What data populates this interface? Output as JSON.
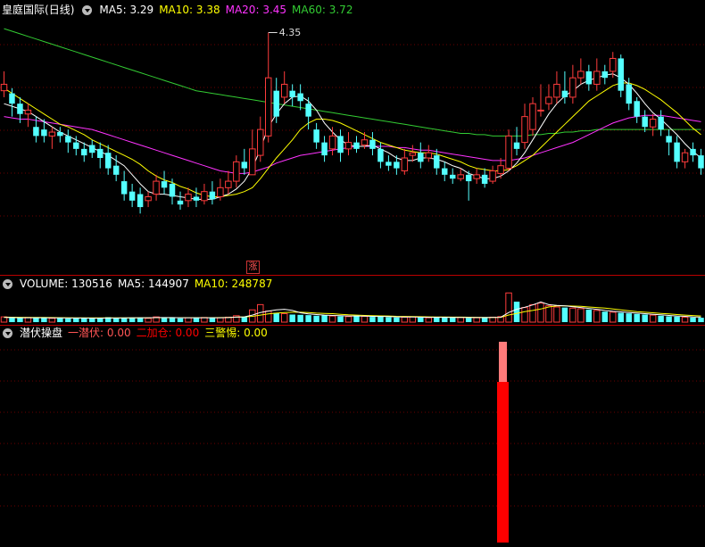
{
  "main": {
    "stock_name": "皇庭国际",
    "period": "(日线)",
    "ma5": {
      "label": "MA5:",
      "value": "3.29",
      "color": "#ffffff"
    },
    "ma10": {
      "label": "MA10:",
      "value": "3.38",
      "color": "#ffff00"
    },
    "ma20": {
      "label": "MA20:",
      "value": "3.45",
      "color": "#ff33ff"
    },
    "ma60": {
      "label": "MA60:",
      "value": "3.72",
      "color": "#33cc33"
    },
    "peak_label": "4.35",
    "up_marker": "涨"
  },
  "volume": {
    "label": "VOLUME:",
    "value": "130516",
    "ma5_label": "MA5:",
    "ma5_value": "144907",
    "ma10_label": "MA10:",
    "ma10_value": "248787"
  },
  "indicator": {
    "title": "潜伏操盘",
    "s1": {
      "label": "一潜伏:",
      "value": "0.00",
      "color": "#ff5555"
    },
    "s2": {
      "label": "二加仓:",
      "value": "0.00",
      "color": "#ff0000"
    },
    "s3": {
      "label": "三警惕:",
      "value": "0.00",
      "color": "#ffff00"
    },
    "bar": {
      "main_value": 1.0,
      "top_value": 0.25
    }
  },
  "chart_data": {
    "type": "candlestick",
    "price_range": [
      2.6,
      4.45
    ],
    "candles": [
      [
        3.9,
        3.95,
        4.05,
        3.85
      ],
      [
        3.88,
        3.8,
        3.92,
        3.7
      ],
      [
        3.8,
        3.72,
        3.85,
        3.65
      ],
      [
        3.72,
        3.75,
        3.8,
        3.62
      ],
      [
        3.62,
        3.55,
        3.7,
        3.5
      ],
      [
        3.6,
        3.55,
        3.68,
        3.5
      ],
      [
        3.55,
        3.58,
        3.62,
        3.45
      ],
      [
        3.58,
        3.55,
        3.62,
        3.5
      ],
      [
        3.55,
        3.5,
        3.6,
        3.42
      ],
      [
        3.5,
        3.45,
        3.55,
        3.4
      ],
      [
        3.45,
        3.4,
        3.5,
        3.35
      ],
      [
        3.48,
        3.42,
        3.52,
        3.38
      ],
      [
        3.45,
        3.38,
        3.5,
        3.3
      ],
      [
        3.42,
        3.3,
        3.48,
        3.25
      ],
      [
        3.32,
        3.25,
        3.4,
        3.2
      ],
      [
        3.2,
        3.1,
        3.28,
        3.05
      ],
      [
        3.12,
        3.05,
        3.18,
        3.0
      ],
      [
        3.1,
        3.0,
        3.15,
        2.95
      ],
      [
        3.05,
        3.08,
        3.12,
        3.0
      ],
      [
        3.1,
        3.2,
        3.25,
        3.05
      ],
      [
        3.2,
        3.15,
        3.28,
        3.1
      ],
      [
        3.18,
        3.08,
        3.22,
        3.02
      ],
      [
        3.05,
        3.02,
        3.12,
        2.98
      ],
      [
        3.05,
        3.1,
        3.15,
        3.0
      ],
      [
        3.08,
        3.05,
        3.15,
        3.0
      ],
      [
        3.05,
        3.12,
        3.18,
        3.02
      ],
      [
        3.12,
        3.06,
        3.2,
        3.02
      ],
      [
        3.08,
        3.15,
        3.22,
        3.05
      ],
      [
        3.15,
        3.2,
        3.28,
        3.1
      ],
      [
        3.2,
        3.35,
        3.4,
        3.15
      ],
      [
        3.35,
        3.3,
        3.45,
        3.25
      ],
      [
        3.25,
        3.45,
        3.6,
        3.25
      ],
      [
        3.4,
        3.6,
        3.7,
        3.35
      ],
      [
        3.55,
        4.0,
        4.35,
        3.5
      ],
      [
        3.9,
        3.7,
        4.0,
        3.65
      ],
      [
        3.85,
        3.95,
        4.05,
        3.8
      ],
      [
        3.9,
        3.85,
        3.95,
        3.78
      ],
      [
        3.88,
        3.82,
        3.95,
        3.75
      ],
      [
        3.8,
        3.7,
        3.85,
        3.6
      ],
      [
        3.6,
        3.5,
        3.65,
        3.45
      ],
      [
        3.5,
        3.4,
        3.55,
        3.35
      ],
      [
        3.45,
        3.55,
        3.62,
        3.4
      ],
      [
        3.55,
        3.42,
        3.6,
        3.35
      ],
      [
        3.45,
        3.5,
        3.58,
        3.4
      ],
      [
        3.5,
        3.45,
        3.55,
        3.42
      ],
      [
        3.48,
        3.52,
        3.58,
        3.45
      ],
      [
        3.52,
        3.45,
        3.58,
        3.4
      ],
      [
        3.45,
        3.35,
        3.5,
        3.3
      ],
      [
        3.35,
        3.32,
        3.4,
        3.28
      ],
      [
        3.35,
        3.3,
        3.4,
        3.25
      ],
      [
        3.28,
        3.38,
        3.45,
        3.25
      ],
      [
        3.4,
        3.42,
        3.48,
        3.35
      ],
      [
        3.42,
        3.35,
        3.5,
        3.3
      ],
      [
        3.38,
        3.42,
        3.48,
        3.35
      ],
      [
        3.4,
        3.3,
        3.45,
        3.25
      ],
      [
        3.3,
        3.25,
        3.35,
        3.2
      ],
      [
        3.25,
        3.22,
        3.3,
        3.18
      ],
      [
        3.22,
        3.25,
        3.3,
        3.2
      ],
      [
        3.25,
        3.2,
        3.28,
        3.05
      ],
      [
        3.22,
        3.25,
        3.3,
        3.18
      ],
      [
        3.25,
        3.18,
        3.3,
        3.15
      ],
      [
        3.2,
        3.28,
        3.32,
        3.18
      ],
      [
        3.26,
        3.32,
        3.38,
        3.22
      ],
      [
        3.3,
        3.55,
        3.6,
        3.28
      ],
      [
        3.5,
        3.45,
        3.62,
        3.4
      ],
      [
        3.5,
        3.7,
        3.8,
        3.45
      ],
      [
        3.6,
        3.8,
        3.85,
        3.55
      ],
      [
        3.75,
        3.75,
        3.95,
        3.7
      ],
      [
        3.8,
        3.85,
        3.95,
        3.75
      ],
      [
        3.85,
        3.95,
        4.05,
        3.8
      ],
      [
        3.9,
        3.85,
        4.05,
        3.8
      ],
      [
        3.85,
        4.0,
        4.1,
        3.8
      ],
      [
        4.0,
        4.05,
        4.15,
        3.95
      ],
      [
        4.05,
        3.95,
        4.1,
        3.9
      ],
      [
        3.95,
        4.05,
        4.15,
        3.9
      ],
      [
        4.05,
        4.0,
        4.1,
        3.95
      ],
      [
        4.05,
        4.15,
        4.2,
        4.0
      ],
      [
        4.15,
        3.9,
        4.18,
        3.85
      ],
      [
        3.95,
        3.8,
        4.0,
        3.75
      ],
      [
        3.82,
        3.7,
        3.85,
        3.65
      ],
      [
        3.7,
        3.62,
        3.75,
        3.58
      ],
      [
        3.62,
        3.68,
        3.72,
        3.55
      ],
      [
        3.7,
        3.6,
        3.75,
        3.55
      ],
      [
        3.55,
        3.5,
        3.6,
        3.4
      ],
      [
        3.5,
        3.35,
        3.55,
        3.3
      ],
      [
        3.35,
        3.42,
        3.45,
        3.3
      ],
      [
        3.45,
        3.4,
        3.5,
        3.35
      ],
      [
        3.4,
        3.3,
        3.45,
        3.25
      ]
    ],
    "ma5": [
      3.8,
      3.78,
      3.76,
      3.74,
      3.7,
      3.66,
      3.62,
      3.58,
      3.55,
      3.52,
      3.49,
      3.46,
      3.43,
      3.4,
      3.36,
      3.32,
      3.25,
      3.18,
      3.12,
      3.1,
      3.1,
      3.09,
      3.08,
      3.07,
      3.06,
      3.06,
      3.06,
      3.08,
      3.1,
      3.14,
      3.2,
      3.3,
      3.45,
      3.62,
      3.72,
      3.8,
      3.85,
      3.86,
      3.82,
      3.75,
      3.65,
      3.58,
      3.52,
      3.48,
      3.47,
      3.47,
      3.48,
      3.45,
      3.42,
      3.38,
      3.36,
      3.36,
      3.38,
      3.38,
      3.37,
      3.35,
      3.32,
      3.3,
      3.26,
      3.24,
      3.22,
      3.22,
      3.24,
      3.28,
      3.34,
      3.42,
      3.52,
      3.62,
      3.72,
      3.8,
      3.86,
      3.9,
      3.95,
      3.98,
      4.0,
      4.02,
      4.03,
      4.0,
      3.95,
      3.88,
      3.8,
      3.73,
      3.68,
      3.62,
      3.56,
      3.49,
      3.43,
      3.38
    ],
    "ma10": [
      3.92,
      3.88,
      3.84,
      3.8,
      3.76,
      3.72,
      3.68,
      3.64,
      3.62,
      3.59,
      3.56,
      3.52,
      3.49,
      3.46,
      3.43,
      3.4,
      3.37,
      3.33,
      3.28,
      3.24,
      3.21,
      3.19,
      3.16,
      3.14,
      3.11,
      3.09,
      3.08,
      3.08,
      3.09,
      3.1,
      3.12,
      3.15,
      3.22,
      3.3,
      3.38,
      3.45,
      3.52,
      3.6,
      3.65,
      3.68,
      3.68,
      3.67,
      3.65,
      3.62,
      3.59,
      3.56,
      3.53,
      3.5,
      3.48,
      3.46,
      3.44,
      3.43,
      3.42,
      3.42,
      3.41,
      3.39,
      3.37,
      3.35,
      3.32,
      3.3,
      3.29,
      3.28,
      3.28,
      3.29,
      3.32,
      3.36,
      3.4,
      3.46,
      3.52,
      3.58,
      3.64,
      3.7,
      3.76,
      3.82,
      3.86,
      3.9,
      3.94,
      3.96,
      3.96,
      3.94,
      3.91,
      3.87,
      3.83,
      3.78,
      3.73,
      3.67,
      3.61,
      3.56
    ],
    "ma20": [
      3.7,
      3.69,
      3.68,
      3.68,
      3.67,
      3.66,
      3.65,
      3.64,
      3.63,
      3.62,
      3.61,
      3.6,
      3.58,
      3.56,
      3.54,
      3.52,
      3.5,
      3.48,
      3.46,
      3.44,
      3.42,
      3.4,
      3.38,
      3.36,
      3.34,
      3.32,
      3.3,
      3.28,
      3.27,
      3.26,
      3.26,
      3.27,
      3.29,
      3.31,
      3.34,
      3.36,
      3.38,
      3.4,
      3.41,
      3.42,
      3.43,
      3.44,
      3.45,
      3.46,
      3.47,
      3.47,
      3.47,
      3.47,
      3.47,
      3.46,
      3.46,
      3.45,
      3.44,
      3.44,
      3.43,
      3.42,
      3.41,
      3.4,
      3.39,
      3.38,
      3.37,
      3.36,
      3.36,
      3.36,
      3.37,
      3.38,
      3.4,
      3.42,
      3.44,
      3.46,
      3.48,
      3.5,
      3.53,
      3.56,
      3.59,
      3.62,
      3.65,
      3.67,
      3.69,
      3.7,
      3.71,
      3.71,
      3.71,
      3.7,
      3.69,
      3.68,
      3.67,
      3.66
    ],
    "ma60": [
      4.38,
      4.36,
      4.34,
      4.32,
      4.3,
      4.28,
      4.26,
      4.24,
      4.22,
      4.2,
      4.18,
      4.16,
      4.14,
      4.12,
      4.1,
      4.08,
      4.06,
      4.04,
      4.02,
      4.0,
      3.98,
      3.96,
      3.94,
      3.92,
      3.9,
      3.89,
      3.88,
      3.87,
      3.86,
      3.85,
      3.84,
      3.83,
      3.82,
      3.81,
      3.8,
      3.79,
      3.78,
      3.77,
      3.76,
      3.75,
      3.74,
      3.73,
      3.72,
      3.71,
      3.7,
      3.69,
      3.68,
      3.67,
      3.66,
      3.65,
      3.64,
      3.63,
      3.62,
      3.61,
      3.6,
      3.59,
      3.58,
      3.57,
      3.57,
      3.56,
      3.56,
      3.55,
      3.55,
      3.55,
      3.55,
      3.55,
      3.56,
      3.56,
      3.57,
      3.57,
      3.58,
      3.58,
      3.59,
      3.59,
      3.6,
      3.6,
      3.6,
      3.6,
      3.6,
      3.6,
      3.6,
      3.6,
      3.6,
      3.6,
      3.6,
      3.6,
      3.6,
      3.6
    ],
    "volume_max": 1100000,
    "volumes": [
      180000,
      150000,
      140000,
      160000,
      150000,
      140000,
      130000,
      150000,
      120000,
      130000,
      140000,
      120000,
      150000,
      170000,
      130000,
      140000,
      150000,
      160000,
      130000,
      180000,
      150000,
      140000,
      130000,
      150000,
      140000,
      160000,
      140000,
      150000,
      170000,
      220000,
      180000,
      420000,
      600000,
      380000,
      320000,
      290000,
      260000,
      250000,
      240000,
      220000,
      230000,
      210000,
      200000,
      190000,
      220000,
      200000,
      180000,
      190000,
      170000,
      160000,
      170000,
      180000,
      160000,
      150000,
      170000,
      160000,
      150000,
      160000,
      140000,
      150000,
      160000,
      170000,
      190000,
      1000000,
      700000,
      500000,
      600000,
      650000,
      560000,
      520000,
      500000,
      480000,
      460000,
      430000,
      400000,
      360000,
      340000,
      320000,
      300000,
      280000,
      260000,
      240000,
      220000,
      200000,
      190000,
      170000,
      160000,
      150000
    ],
    "vol_ma5": [
      160000,
      155000,
      150000,
      150000,
      150000,
      150000,
      145000,
      145000,
      140000,
      140000,
      140000,
      135000,
      135000,
      140000,
      140000,
      145000,
      150000,
      150000,
      150000,
      155000,
      155000,
      155000,
      150000,
      150000,
      150000,
      150000,
      150000,
      150000,
      155000,
      170000,
      180000,
      240000,
      330000,
      380000,
      420000,
      440000,
      400000,
      320000,
      280000,
      260000,
      240000,
      230000,
      220000,
      210000,
      210000,
      205000,
      200000,
      195000,
      190000,
      180000,
      175000,
      175000,
      170000,
      165000,
      165000,
      165000,
      160000,
      160000,
      155000,
      155000,
      155000,
      160000,
      165000,
      330000,
      440000,
      510000,
      590000,
      690000,
      600000,
      570000,
      560000,
      530000,
      500000,
      470000,
      440000,
      400000,
      370000,
      350000,
      330000,
      310000,
      290000,
      270000,
      250000,
      230000,
      210000,
      200000,
      180000,
      170000
    ],
    "vol_ma10": [
      170000,
      168000,
      165000,
      162000,
      160000,
      158000,
      155000,
      152000,
      150000,
      148000,
      146000,
      145000,
      144000,
      144000,
      145000,
      146000,
      148000,
      150000,
      150000,
      152000,
      153000,
      153000,
      152000,
      152000,
      152000,
      153000,
      154000,
      155000,
      160000,
      170000,
      180000,
      200000,
      240000,
      280000,
      310000,
      330000,
      340000,
      340000,
      330000,
      310000,
      300000,
      290000,
      270000,
      250000,
      240000,
      230000,
      220000,
      215000,
      210000,
      200000,
      195000,
      190000,
      185000,
      180000,
      178000,
      175000,
      172000,
      170000,
      168000,
      165000,
      163000,
      163000,
      165000,
      245000,
      300000,
      360000,
      400000,
      450000,
      520000,
      560000,
      560000,
      550000,
      540000,
      520000,
      500000,
      480000,
      450000,
      420000,
      390000,
      360000,
      340000,
      320000,
      300000,
      280000,
      260000,
      240000,
      225000,
      210000
    ]
  }
}
